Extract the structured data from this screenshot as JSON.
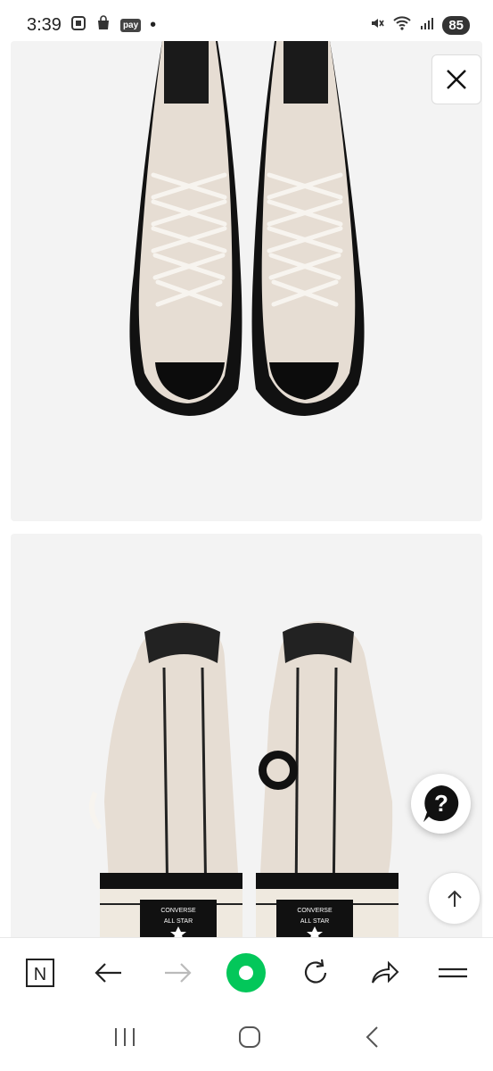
{
  "status_bar": {
    "time": "3:39",
    "pay_label": "pay",
    "dot": "•",
    "battery": "85",
    "icons": [
      "screenshot-icon",
      "shopping-bag-icon",
      "pay-icon",
      "mute-icon",
      "wifi-icon",
      "signal-icon",
      "battery-icon"
    ]
  },
  "gallery": {
    "images": [
      {
        "name": "sneakers-top-view",
        "colors": {
          "canvas": "#e6ddd3",
          "rubber": "#111111"
        }
      },
      {
        "name": "sneakers-back-view",
        "colors": {
          "canvas": "#e6ddd3",
          "rubber": "#111111"
        }
      }
    ],
    "heel_label": {
      "brand": "CONVERSE",
      "line": "ALL STAR"
    }
  },
  "overlay": {
    "close_icon": "close-icon",
    "help_icon": "question-icon",
    "scroll_top_icon": "arrow-up-icon"
  },
  "browser_toolbar": {
    "items": [
      "naver-home-icon",
      "back-arrow-icon",
      "forward-arrow-icon",
      "green-dot-icon",
      "reload-icon",
      "share-icon",
      "menu-icon"
    ],
    "naver_letter": "N",
    "accent": "#03c75a"
  },
  "nav_bar": {
    "items": [
      "recent-apps-icon",
      "home-icon",
      "back-icon"
    ]
  }
}
